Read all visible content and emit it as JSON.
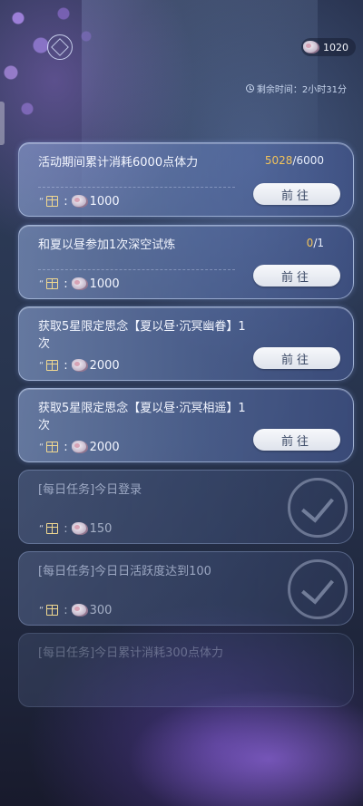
{
  "currency": {
    "icon": "gem-icon",
    "amount": "1020"
  },
  "timer": {
    "icon": "clock-icon",
    "text": "剩余时间：2小时31分"
  },
  "colors": {
    "accent_progress": "#f2c35a",
    "button_bg": "#eef0f5",
    "button_text": "#3c4a66"
  },
  "tasks": [
    {
      "title": "活动期间累计消耗6000点体力",
      "progress_current": "5028",
      "progress_total": "/6000",
      "reward_icon": "gem-icon",
      "reward_amount": "1000",
      "button_label": "前往"
    },
    {
      "title": "和夏以昼参加1次深空试炼",
      "progress_current": "0",
      "progress_total": "/1",
      "reward_icon": "gem-icon",
      "reward_amount": "1000",
      "button_label": "前往"
    },
    {
      "title": "获取5星限定思念【夏以昼·沉冥幽眷】1次",
      "reward_icon": "gem-icon",
      "reward_amount": "2000",
      "button_label": "前往"
    },
    {
      "title": "获取5星限定思念【夏以昼·沉冥相遥】1次",
      "reward_icon": "gem-icon",
      "reward_amount": "2000",
      "button_label": "前往"
    },
    {
      "title": "[每日任务]今日登录",
      "reward_icon": "gem-icon",
      "reward_amount": "150",
      "status": "completed"
    },
    {
      "title": "[每日任务]今日日活跃度达到100",
      "reward_icon": "gem-icon",
      "reward_amount": "300",
      "status": "completed"
    },
    {
      "title": "[每日任务]今日累计消耗300点体力",
      "status": "completed"
    }
  ]
}
